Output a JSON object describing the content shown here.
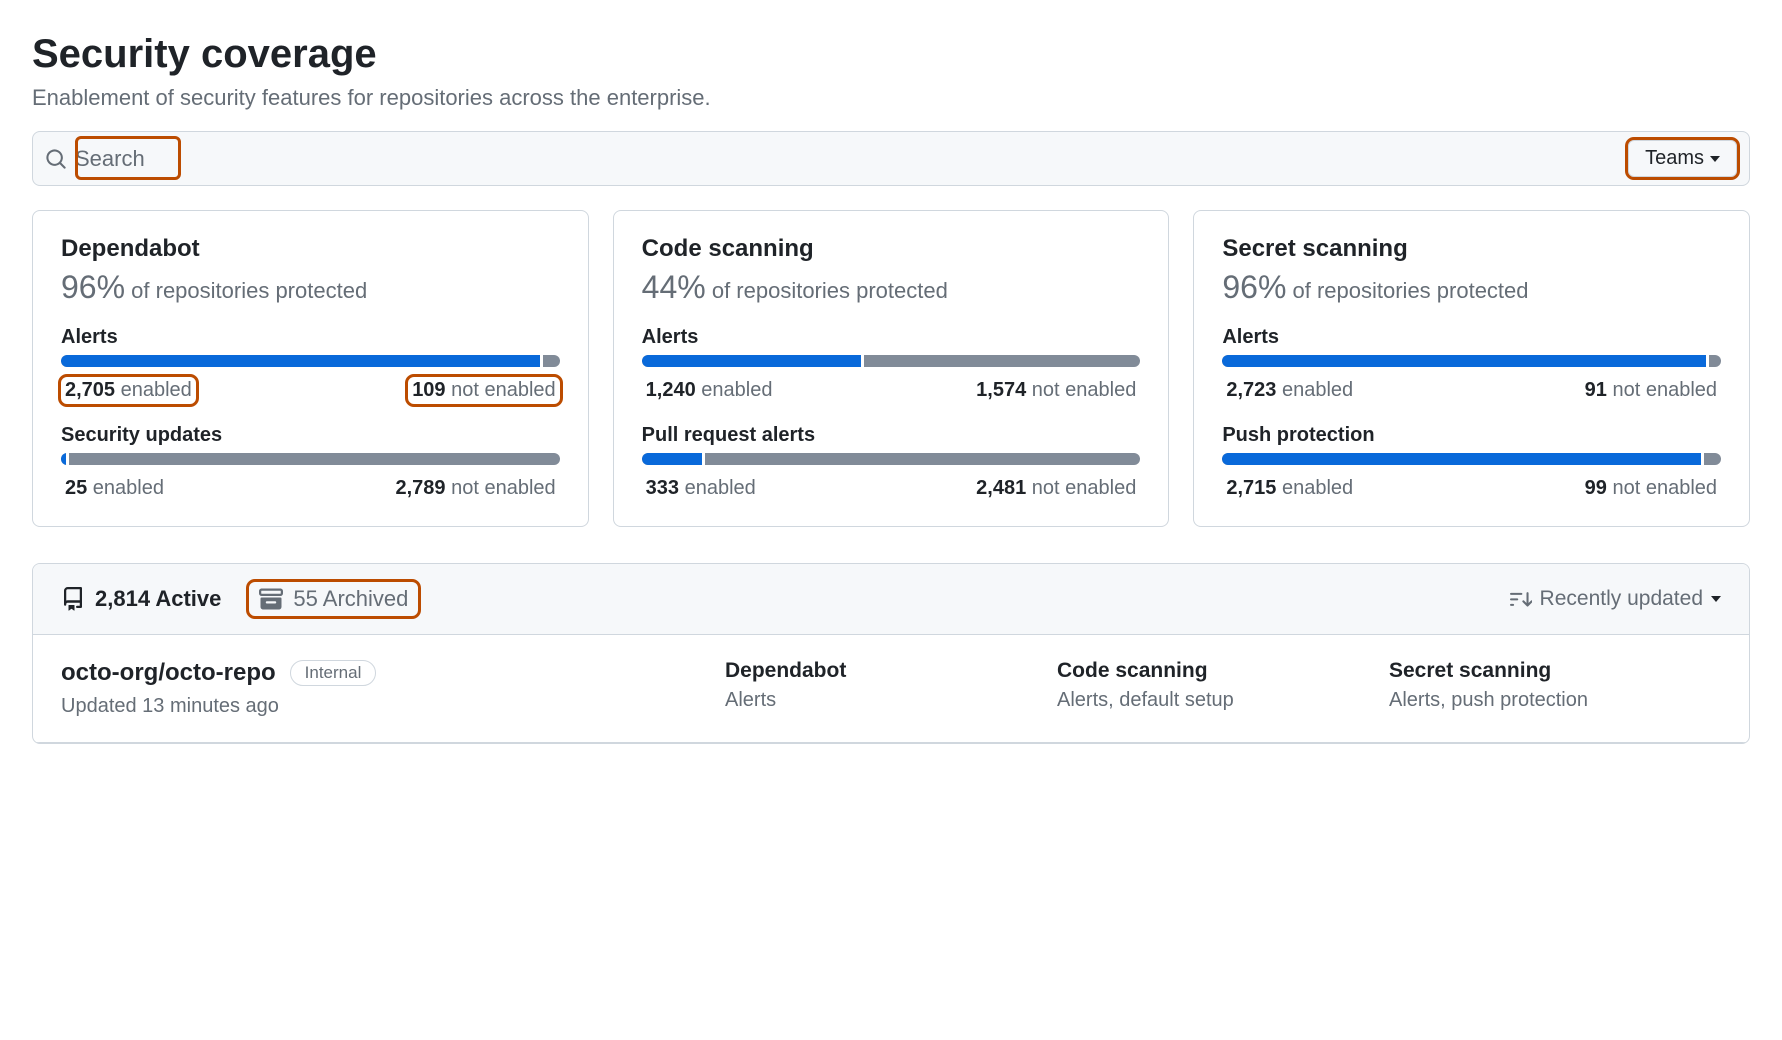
{
  "header": {
    "title": "Security coverage",
    "subtitle": "Enablement of security features for repositories across the enterprise."
  },
  "search": {
    "placeholder": "Search",
    "teams_label": "Teams"
  },
  "cards": [
    {
      "title": "Dependabot",
      "pct": "96%",
      "pct_suffix": "of repositories protected",
      "features": [
        {
          "label": "Alerts",
          "fill": 96,
          "enabled_n": "2,705",
          "enabled_t": "enabled",
          "not_n": "109",
          "not_t": "not enabled",
          "hl_enabled": true,
          "hl_not": true
        },
        {
          "label": "Security updates",
          "fill": 1,
          "enabled_n": "25",
          "enabled_t": "enabled",
          "not_n": "2,789",
          "not_t": "not enabled"
        }
      ]
    },
    {
      "title": "Code scanning",
      "pct": "44%",
      "pct_suffix": "of repositories protected",
      "features": [
        {
          "label": "Alerts",
          "fill": 44,
          "enabled_n": "1,240",
          "enabled_t": "enabled",
          "not_n": "1,574",
          "not_t": "not enabled"
        },
        {
          "label": "Pull request alerts",
          "fill": 12,
          "enabled_n": "333",
          "enabled_t": "enabled",
          "not_n": "2,481",
          "not_t": "not enabled"
        }
      ]
    },
    {
      "title": "Secret scanning",
      "pct": "96%",
      "pct_suffix": "of repositories protected",
      "features": [
        {
          "label": "Alerts",
          "fill": 97,
          "enabled_n": "2,723",
          "enabled_t": "enabled",
          "not_n": "91",
          "not_t": "not enabled"
        },
        {
          "label": "Push protection",
          "fill": 96,
          "enabled_n": "2,715",
          "enabled_t": "enabled",
          "not_n": "99",
          "not_t": "not enabled"
        }
      ]
    }
  ],
  "repo_list": {
    "active_count": "2,814",
    "active_label": "Active",
    "archived_count": "55",
    "archived_label": "Archived",
    "sort_label": "Recently updated",
    "rows": [
      {
        "name": "octo-org/octo-repo",
        "visibility": "Internal",
        "updated": "Updated 13 minutes ago",
        "cols": [
          {
            "title": "Dependabot",
            "sub": "Alerts"
          },
          {
            "title": "Code scanning",
            "sub": "Alerts, default setup"
          },
          {
            "title": "Secret scanning",
            "sub": "Alerts, push protection"
          }
        ]
      }
    ]
  }
}
